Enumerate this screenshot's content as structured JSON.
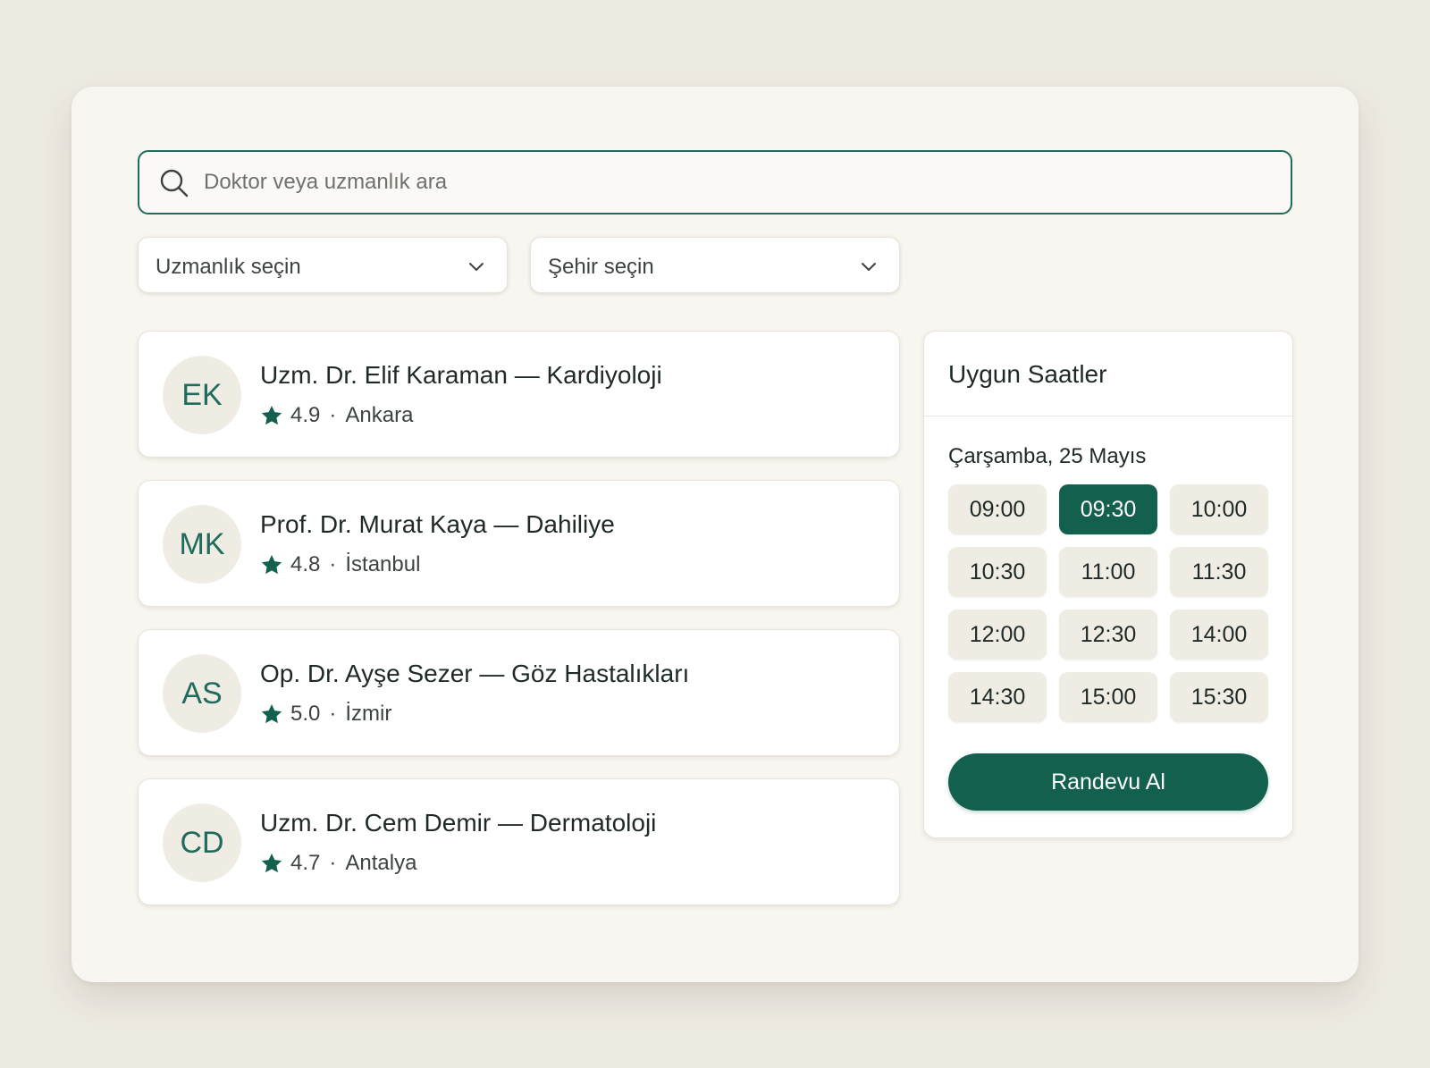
{
  "search": {
    "placeholder": "Doktor veya uzmanlık ara"
  },
  "filters": {
    "specialty": "Uzmanlık seçin",
    "city": "Şehir seçin"
  },
  "doctors": [
    {
      "initials": "EK",
      "name": "Uzm. Dr. Elif Karaman — Kardiyoloji",
      "rating": "4.9",
      "city": "Ankara"
    },
    {
      "initials": "MK",
      "name": "Prof. Dr. Murat Kaya — Dahiliye",
      "rating": "4.8",
      "city": "İstanbul"
    },
    {
      "initials": "AS",
      "name": "Op. Dr. Ayşe Sezer — Göz Hastalıkları",
      "rating": "5.0",
      "city": "İzmir"
    },
    {
      "initials": "CD",
      "name": "Uzm. Dr. Cem Demir — Dermatoloji",
      "rating": "4.7",
      "city": "Antalya"
    }
  ],
  "separator": "·",
  "slots": {
    "title": "Uygun Saatler",
    "date": "Çarşamba, 25 Mayıs",
    "times": [
      "09:00",
      "09:30",
      "10:00",
      "10:30",
      "11:00",
      "11:30",
      "12:00",
      "12:30",
      "14:00",
      "14:30",
      "15:00",
      "15:30"
    ],
    "selected": "09:30",
    "book_label": "Randevu Al"
  },
  "colors": {
    "accent": "#14604f",
    "background": "#edeae2",
    "panel": "#f8f6f0"
  }
}
